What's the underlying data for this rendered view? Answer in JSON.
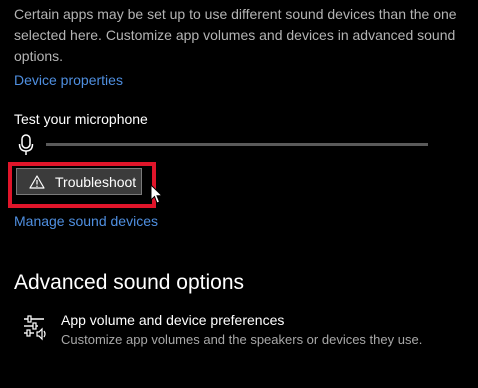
{
  "description": {
    "line1": "Certain apps may be set up to use different sound devices than the one",
    "line2": "selected here. Customize app volumes and devices in advanced sound",
    "line3": "options."
  },
  "links": {
    "device_properties": "Device properties",
    "manage_sound_devices": "Manage sound devices"
  },
  "microphone": {
    "label": "Test your microphone",
    "level": 0
  },
  "troubleshoot_button": {
    "label": "Troubleshoot",
    "icon": "warning-icon"
  },
  "advanced": {
    "heading": "Advanced sound options",
    "item": {
      "icon": "mixer-sliders-icon",
      "title": "App volume and device preferences",
      "subtitle": "Customize app volumes and the speakers or devices they use."
    }
  },
  "colors": {
    "background": "#000000",
    "link": "#4f8fe0",
    "highlight_box": "#e0152a"
  }
}
